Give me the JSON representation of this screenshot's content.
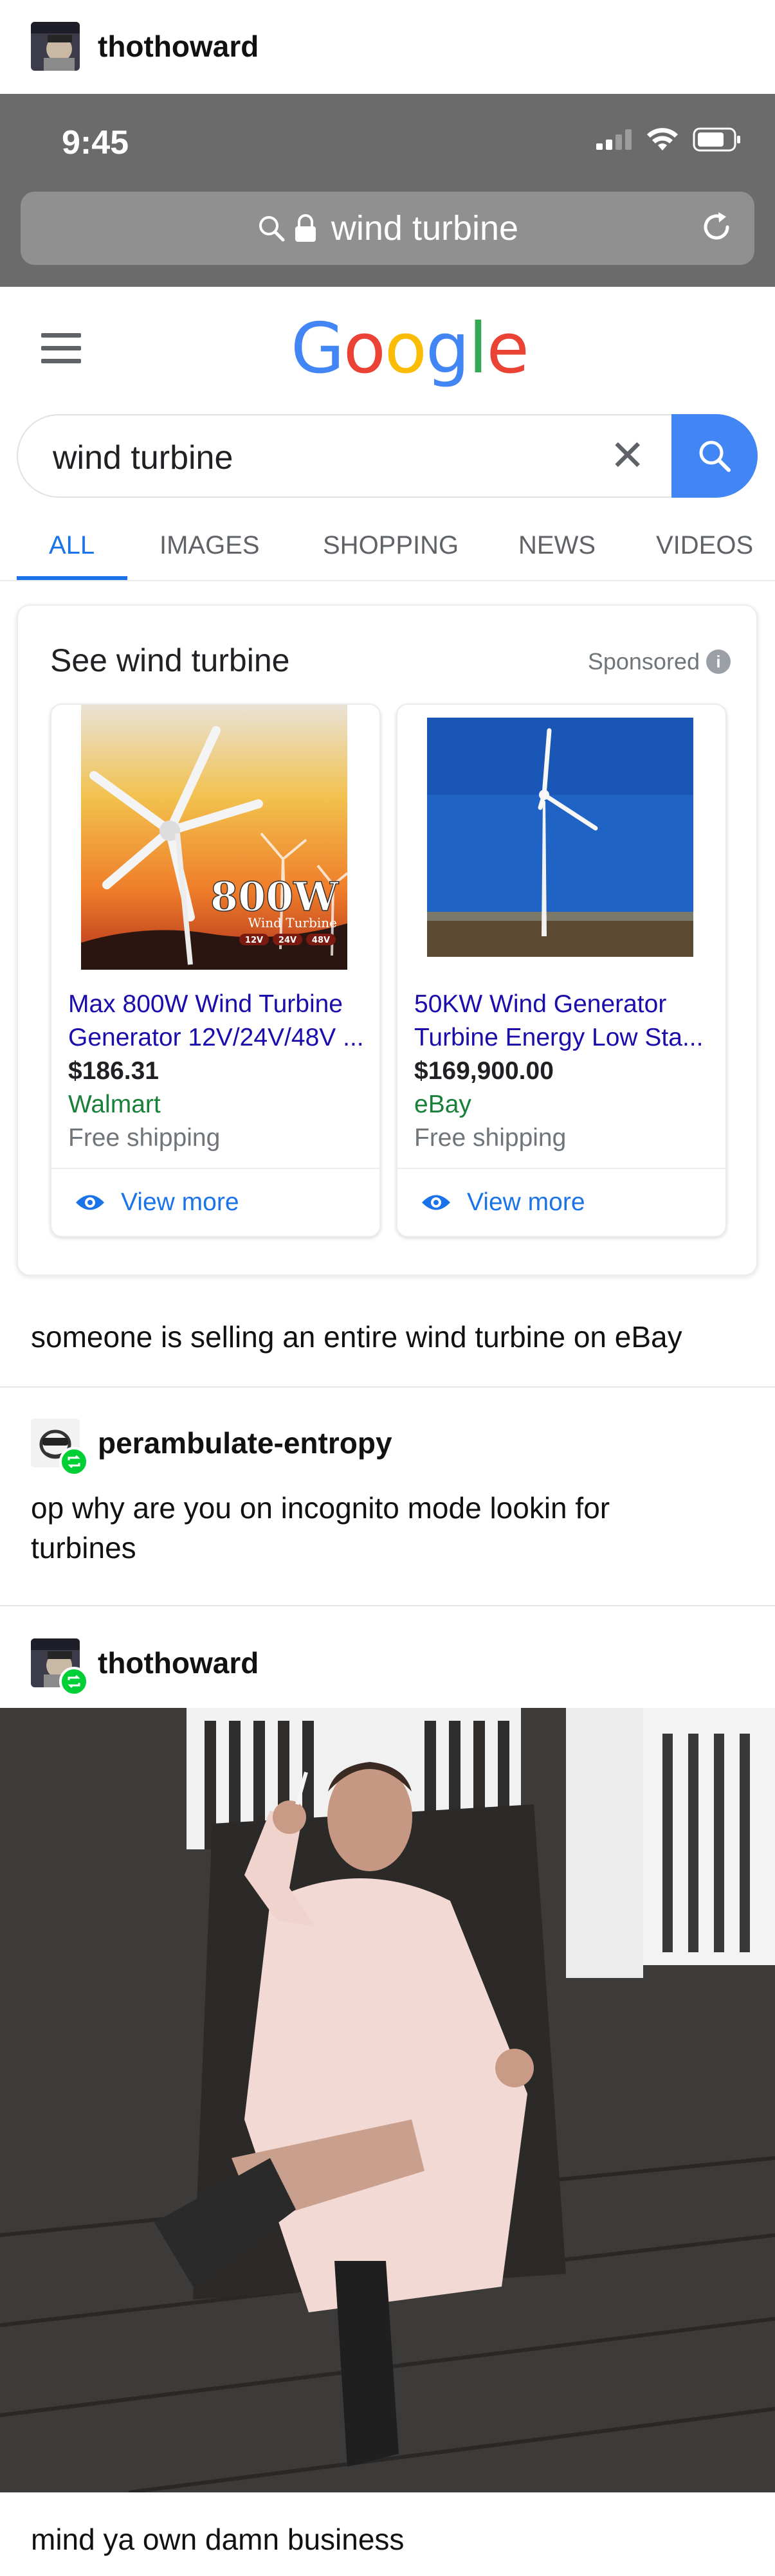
{
  "posts": [
    {
      "username": "thothoward"
    },
    {
      "username": "perambulate-entropy",
      "text_lines": [
        "op why are you on incognito mode lookin for",
        "turbines"
      ]
    },
    {
      "username": "thothoward",
      "caption": "mind ya own damn business"
    }
  ],
  "first_post_caption": "someone is selling an entire wind turbine on eBay",
  "phone": {
    "time": "9:45",
    "url": "wind turbine"
  },
  "google": {
    "logo_letters": [
      "G",
      "o",
      "o",
      "g",
      "l",
      "e"
    ],
    "logo_colors": [
      "#4285f4",
      "#ea4335",
      "#fbbc05",
      "#4285f4",
      "#34a853",
      "#ea4335"
    ],
    "search_value": "wind turbine",
    "clear_symbol": "✕",
    "tabs": [
      "ALL",
      "IMAGES",
      "SHOPPING",
      "NEWS",
      "VIDEOS"
    ],
    "active_tab": "ALL"
  },
  "shopping": {
    "title": "See wind turbine",
    "sponsored": "Sponsored",
    "info_symbol": "i",
    "products": [
      {
        "title_lines": [
          "Max 800W Wind Turbine",
          "Generator 12V/24V/48V ..."
        ],
        "price": "$186.31",
        "store": "Walmart",
        "shipping": "Free shipping",
        "view_more": "View more",
        "image_text": {
          "big": "800W",
          "sub": "Wind Turbine",
          "badges": [
            "12V",
            "24V",
            "48V"
          ]
        }
      },
      {
        "title_lines": [
          "50KW Wind Generator",
          "Turbine Energy Low Sta..."
        ],
        "price": "$169,900.00",
        "store": "eBay",
        "shipping": "Free shipping",
        "view_more": "View more"
      }
    ]
  },
  "icons": {
    "search": "search-icon",
    "lock": "lock-icon",
    "reload": "reload-icon",
    "menu": "hamburger-menu-icon",
    "eye": "eye-icon",
    "reblog": "reblog-icon"
  },
  "colors": {
    "link_blue": "#1a0dab",
    "tab_blue": "#1a73e8",
    "store_green": "#188038",
    "status_gray": "#6b6b6b",
    "reblog_green": "#00cf35"
  }
}
